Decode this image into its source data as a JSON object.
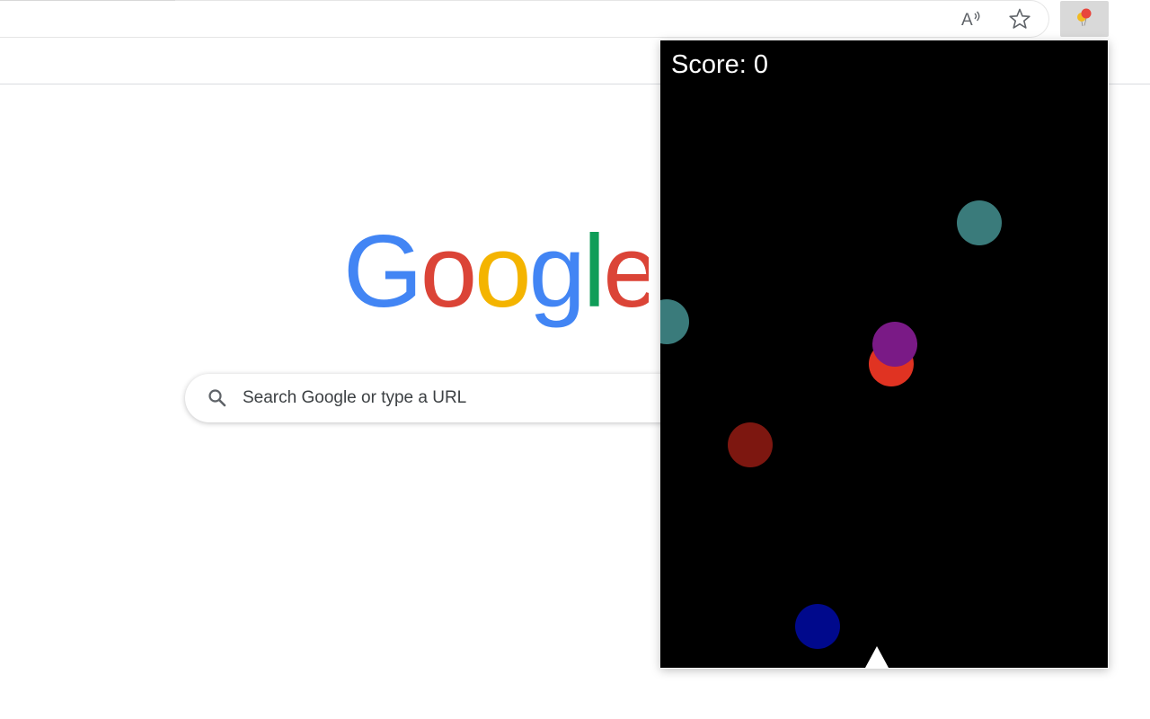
{
  "browser": {
    "toolbar": {
      "read_aloud_icon": "read-aloud-icon",
      "favorite_icon": "star-outline-icon",
      "extension_icon": "balloons-icon"
    }
  },
  "new_tab_page": {
    "logo_text": "Google",
    "logo_colors": [
      "#4285F4",
      "#DB4437",
      "#F4B400",
      "#4285F4",
      "#0F9D58",
      "#DB4437"
    ],
    "search": {
      "placeholder": "Search Google or type a URL",
      "value": ""
    }
  },
  "game_popup": {
    "score_label": "Score: 0",
    "background_color": "#000000",
    "player_shape": "triangle",
    "player_color": "#ffffff",
    "balls": [
      {
        "color": "#3a7b7b",
        "name": "teal-ball"
      },
      {
        "color": "#3a7b7b",
        "name": "teal-ball-partial"
      },
      {
        "color": "#e03322",
        "name": "red-ball"
      },
      {
        "color": "#7a1a86",
        "name": "purple-ball"
      },
      {
        "color": "#7d1710",
        "name": "dark-red-ball"
      },
      {
        "color": "#00098c",
        "name": "blue-ball"
      }
    ]
  }
}
